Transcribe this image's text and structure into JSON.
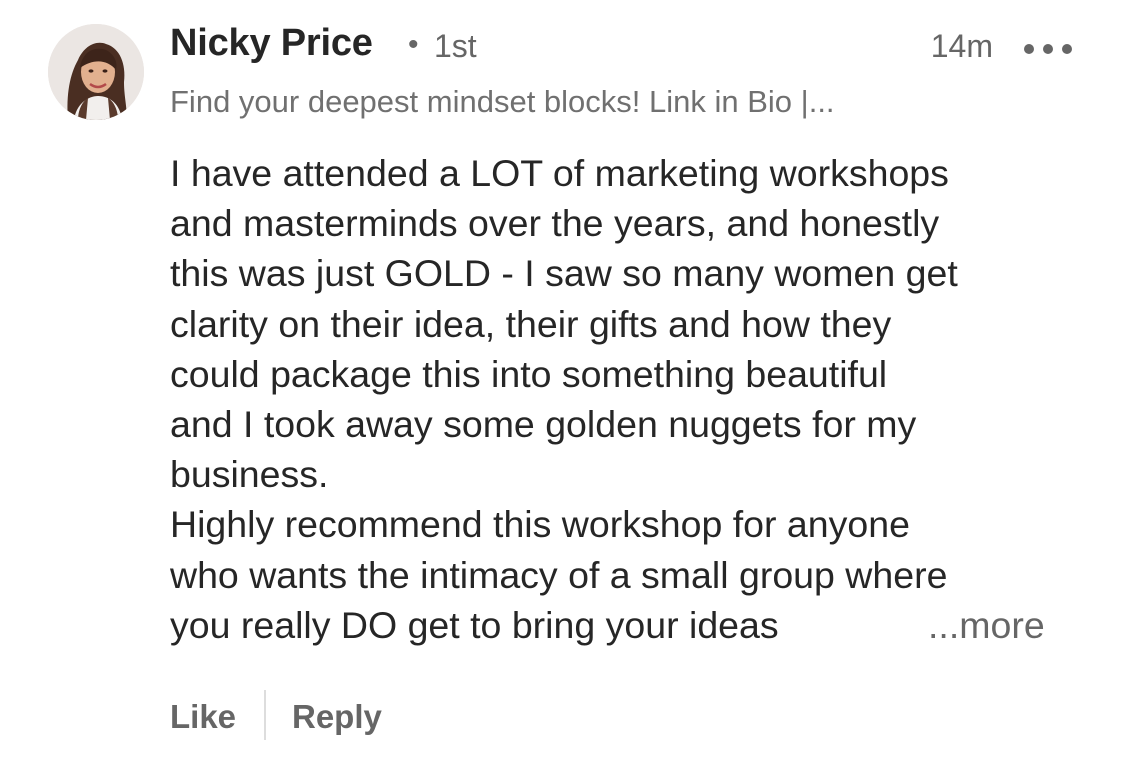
{
  "comment": {
    "author": {
      "name": "Nicky Price",
      "separator": "•",
      "connection_degree": "1st",
      "headline": "Find your deepest mindset blocks! Link in Bio |..."
    },
    "timestamp": "14m",
    "menu_icon": "more-horizontal-icon",
    "body_lines": [
      "I have attended a LOT of marketing workshops",
      "and masterminds over the years, and honestly",
      "this was just GOLD - I saw so many women get",
      "clarity on their idea, their gifts and how they",
      "could package this into something beautiful",
      "and I took away some golden nuggets for my",
      "business.",
      "Highly recommend this workshop for anyone",
      "who wants the intimacy of a small group where",
      "you really DO get to bring your ideas"
    ],
    "see_more_label": "...more"
  },
  "actions": {
    "like_label": "Like",
    "reply_label": "Reply"
  },
  "colors": {
    "text_primary": "#262626",
    "text_secondary": "#666666",
    "divider": "#dddddd",
    "background": "#ffffff"
  }
}
